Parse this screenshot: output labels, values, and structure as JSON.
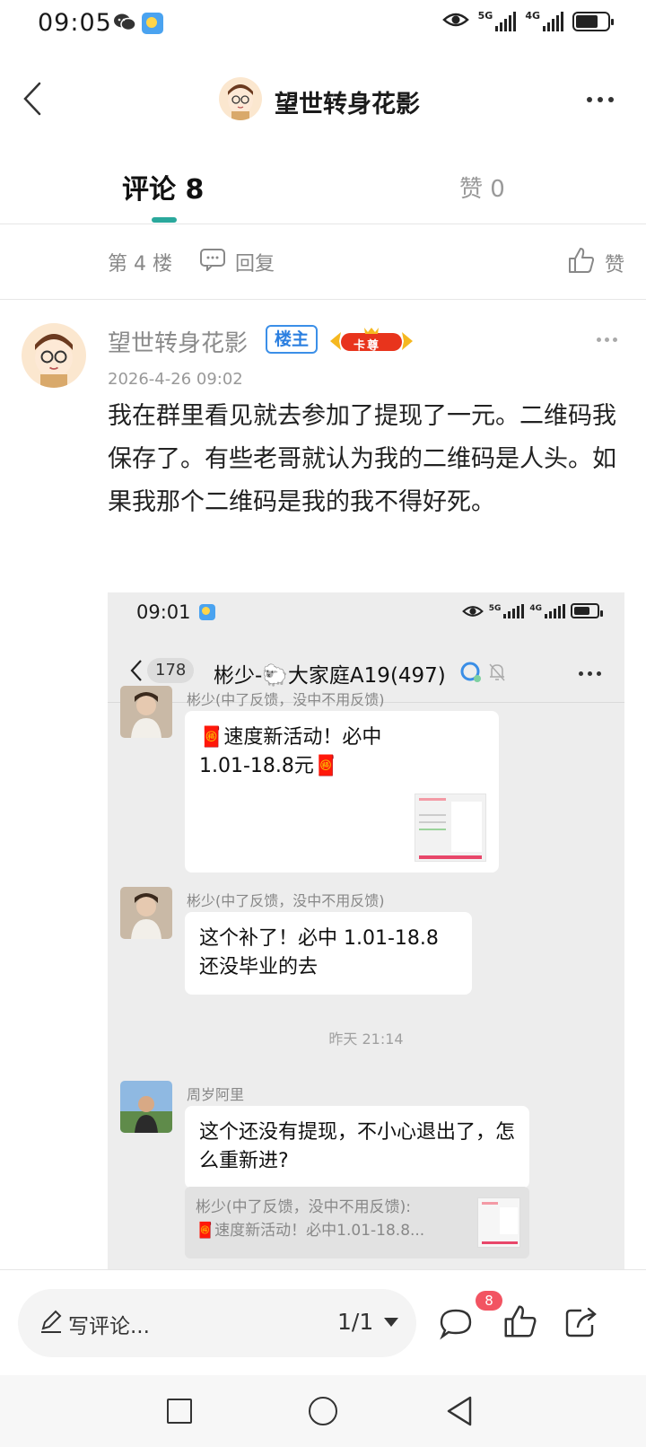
{
  "status_bar": {
    "time": "09:05",
    "network1": "5G",
    "network2": "4G",
    "icons": [
      "wechat-icon",
      "weather-icon",
      "eye-icon",
      "signal-icon",
      "battery-icon"
    ]
  },
  "header": {
    "title": "望世转身花影",
    "back_icon": "back-arrow-icon",
    "more_icon": "more-dots-icon"
  },
  "tabs": [
    {
      "label": "评论 8",
      "active": true
    },
    {
      "label": "赞 0",
      "active": false
    }
  ],
  "floor_bar": {
    "floor_label": "第 4 楼",
    "reply_label": "回复",
    "like_label": "赞"
  },
  "comment": {
    "author": "望世转身花影",
    "owner_badge": "楼主",
    "vip_badge": "卡尊",
    "date": "2026-4-26 09:02",
    "text": "我在群里看见就去参加了提现了一元。二维码我保存了。有些老哥就认为我的二维码是人头。如果我那个二维码是我的我不得好死。"
  },
  "screenshot": {
    "time": "09:01",
    "network1": "5G",
    "network2": "4G",
    "unread_count": "178",
    "chat_title": "彬少-🐑大家庭A19(497)",
    "messages": [
      {
        "sender": "彬少(中了反馈，没中不用反馈)",
        "text": "🧧速度新活动！必中1.01-18.8元🧧",
        "has_image": true
      },
      {
        "sender": "彬少(中了反馈，没中不用反馈)",
        "text": "这个补了！必中 1.01-18.8\n还没毕业的去",
        "has_image": false
      }
    ],
    "time_divider": "昨天 21:14",
    "reply_message": {
      "sender": "周岁阿里",
      "text": "这个还没有提现，不小心退出了，怎么重新进?"
    },
    "quote": {
      "line1": "彬少(中了反馈，没中不用反馈):",
      "line2": "🧧速度新活动！必中1.01-18.8..."
    }
  },
  "bottom_bar": {
    "compose_placeholder": "写评论...",
    "page_indicator": "1/1",
    "comment_count_badge": "8",
    "icons": [
      "comment-icon",
      "thumbs-up-icon",
      "share-icon"
    ]
  },
  "nav_bar": {
    "icons": [
      "recent-apps-icon",
      "home-icon",
      "back-icon"
    ]
  },
  "colors": {
    "accent": "#2aa89c",
    "owner_badge": "#3b8fe8",
    "badge_red": "#f25462"
  }
}
